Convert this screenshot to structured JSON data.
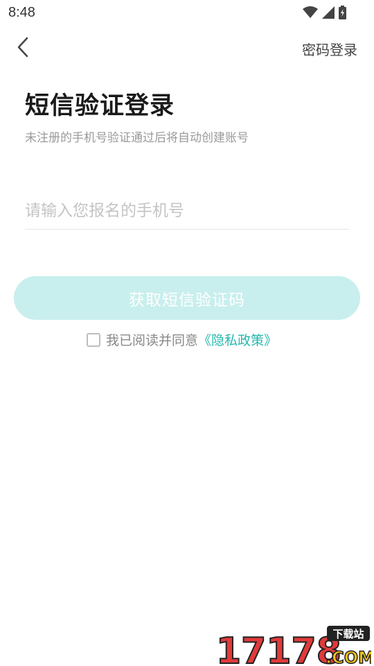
{
  "status_bar": {
    "time": "8:48"
  },
  "header": {
    "password_login_label": "密码登录"
  },
  "main": {
    "title": "短信验证登录",
    "subtitle": "未注册的手机号验证通过后将自动创建账号",
    "phone_input": {
      "value": "",
      "placeholder": "请输入您报名的手机号"
    },
    "get_code_label": "获取短信验证码",
    "agree_prefix": "我已阅读并同意",
    "privacy_link": "《隐私政策》"
  },
  "watermark": {
    "number": "17178",
    "dotcom": ".COM",
    "tag": "下载站"
  },
  "colors": {
    "accent": "#26b8ad",
    "button_disabled_bg": "#c8efed",
    "watermark_red": "#e03a3a",
    "watermark_yellow": "#f5c518"
  },
  "icons": {
    "back": "chevron-left-icon",
    "wifi": "wifi-icon",
    "signal": "signal-icon",
    "battery": "battery-icon"
  }
}
